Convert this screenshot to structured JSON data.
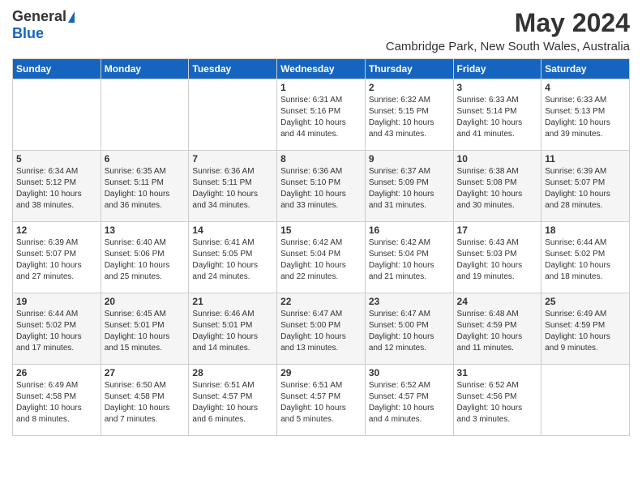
{
  "logo": {
    "general": "General",
    "blue": "Blue"
  },
  "title": "May 2024",
  "subtitle": "Cambridge Park, New South Wales, Australia",
  "weekdays": [
    "Sunday",
    "Monday",
    "Tuesday",
    "Wednesday",
    "Thursday",
    "Friday",
    "Saturday"
  ],
  "weeks": [
    [
      {
        "day": "",
        "info": ""
      },
      {
        "day": "",
        "info": ""
      },
      {
        "day": "",
        "info": ""
      },
      {
        "day": "1",
        "info": "Sunrise: 6:31 AM\nSunset: 5:16 PM\nDaylight: 10 hours\nand 44 minutes."
      },
      {
        "day": "2",
        "info": "Sunrise: 6:32 AM\nSunset: 5:15 PM\nDaylight: 10 hours\nand 43 minutes."
      },
      {
        "day": "3",
        "info": "Sunrise: 6:33 AM\nSunset: 5:14 PM\nDaylight: 10 hours\nand 41 minutes."
      },
      {
        "day": "4",
        "info": "Sunrise: 6:33 AM\nSunset: 5:13 PM\nDaylight: 10 hours\nand 39 minutes."
      }
    ],
    [
      {
        "day": "5",
        "info": "Sunrise: 6:34 AM\nSunset: 5:12 PM\nDaylight: 10 hours\nand 38 minutes."
      },
      {
        "day": "6",
        "info": "Sunrise: 6:35 AM\nSunset: 5:11 PM\nDaylight: 10 hours\nand 36 minutes."
      },
      {
        "day": "7",
        "info": "Sunrise: 6:36 AM\nSunset: 5:11 PM\nDaylight: 10 hours\nand 34 minutes."
      },
      {
        "day": "8",
        "info": "Sunrise: 6:36 AM\nSunset: 5:10 PM\nDaylight: 10 hours\nand 33 minutes."
      },
      {
        "day": "9",
        "info": "Sunrise: 6:37 AM\nSunset: 5:09 PM\nDaylight: 10 hours\nand 31 minutes."
      },
      {
        "day": "10",
        "info": "Sunrise: 6:38 AM\nSunset: 5:08 PM\nDaylight: 10 hours\nand 30 minutes."
      },
      {
        "day": "11",
        "info": "Sunrise: 6:39 AM\nSunset: 5:07 PM\nDaylight: 10 hours\nand 28 minutes."
      }
    ],
    [
      {
        "day": "12",
        "info": "Sunrise: 6:39 AM\nSunset: 5:07 PM\nDaylight: 10 hours\nand 27 minutes."
      },
      {
        "day": "13",
        "info": "Sunrise: 6:40 AM\nSunset: 5:06 PM\nDaylight: 10 hours\nand 25 minutes."
      },
      {
        "day": "14",
        "info": "Sunrise: 6:41 AM\nSunset: 5:05 PM\nDaylight: 10 hours\nand 24 minutes."
      },
      {
        "day": "15",
        "info": "Sunrise: 6:42 AM\nSunset: 5:04 PM\nDaylight: 10 hours\nand 22 minutes."
      },
      {
        "day": "16",
        "info": "Sunrise: 6:42 AM\nSunset: 5:04 PM\nDaylight: 10 hours\nand 21 minutes."
      },
      {
        "day": "17",
        "info": "Sunrise: 6:43 AM\nSunset: 5:03 PM\nDaylight: 10 hours\nand 19 minutes."
      },
      {
        "day": "18",
        "info": "Sunrise: 6:44 AM\nSunset: 5:02 PM\nDaylight: 10 hours\nand 18 minutes."
      }
    ],
    [
      {
        "day": "19",
        "info": "Sunrise: 6:44 AM\nSunset: 5:02 PM\nDaylight: 10 hours\nand 17 minutes."
      },
      {
        "day": "20",
        "info": "Sunrise: 6:45 AM\nSunset: 5:01 PM\nDaylight: 10 hours\nand 15 minutes."
      },
      {
        "day": "21",
        "info": "Sunrise: 6:46 AM\nSunset: 5:01 PM\nDaylight: 10 hours\nand 14 minutes."
      },
      {
        "day": "22",
        "info": "Sunrise: 6:47 AM\nSunset: 5:00 PM\nDaylight: 10 hours\nand 13 minutes."
      },
      {
        "day": "23",
        "info": "Sunrise: 6:47 AM\nSunset: 5:00 PM\nDaylight: 10 hours\nand 12 minutes."
      },
      {
        "day": "24",
        "info": "Sunrise: 6:48 AM\nSunset: 4:59 PM\nDaylight: 10 hours\nand 11 minutes."
      },
      {
        "day": "25",
        "info": "Sunrise: 6:49 AM\nSunset: 4:59 PM\nDaylight: 10 hours\nand 9 minutes."
      }
    ],
    [
      {
        "day": "26",
        "info": "Sunrise: 6:49 AM\nSunset: 4:58 PM\nDaylight: 10 hours\nand 8 minutes."
      },
      {
        "day": "27",
        "info": "Sunrise: 6:50 AM\nSunset: 4:58 PM\nDaylight: 10 hours\nand 7 minutes."
      },
      {
        "day": "28",
        "info": "Sunrise: 6:51 AM\nSunset: 4:57 PM\nDaylight: 10 hours\nand 6 minutes."
      },
      {
        "day": "29",
        "info": "Sunrise: 6:51 AM\nSunset: 4:57 PM\nDaylight: 10 hours\nand 5 minutes."
      },
      {
        "day": "30",
        "info": "Sunrise: 6:52 AM\nSunset: 4:57 PM\nDaylight: 10 hours\nand 4 minutes."
      },
      {
        "day": "31",
        "info": "Sunrise: 6:52 AM\nSunset: 4:56 PM\nDaylight: 10 hours\nand 3 minutes."
      },
      {
        "day": "",
        "info": ""
      }
    ]
  ]
}
